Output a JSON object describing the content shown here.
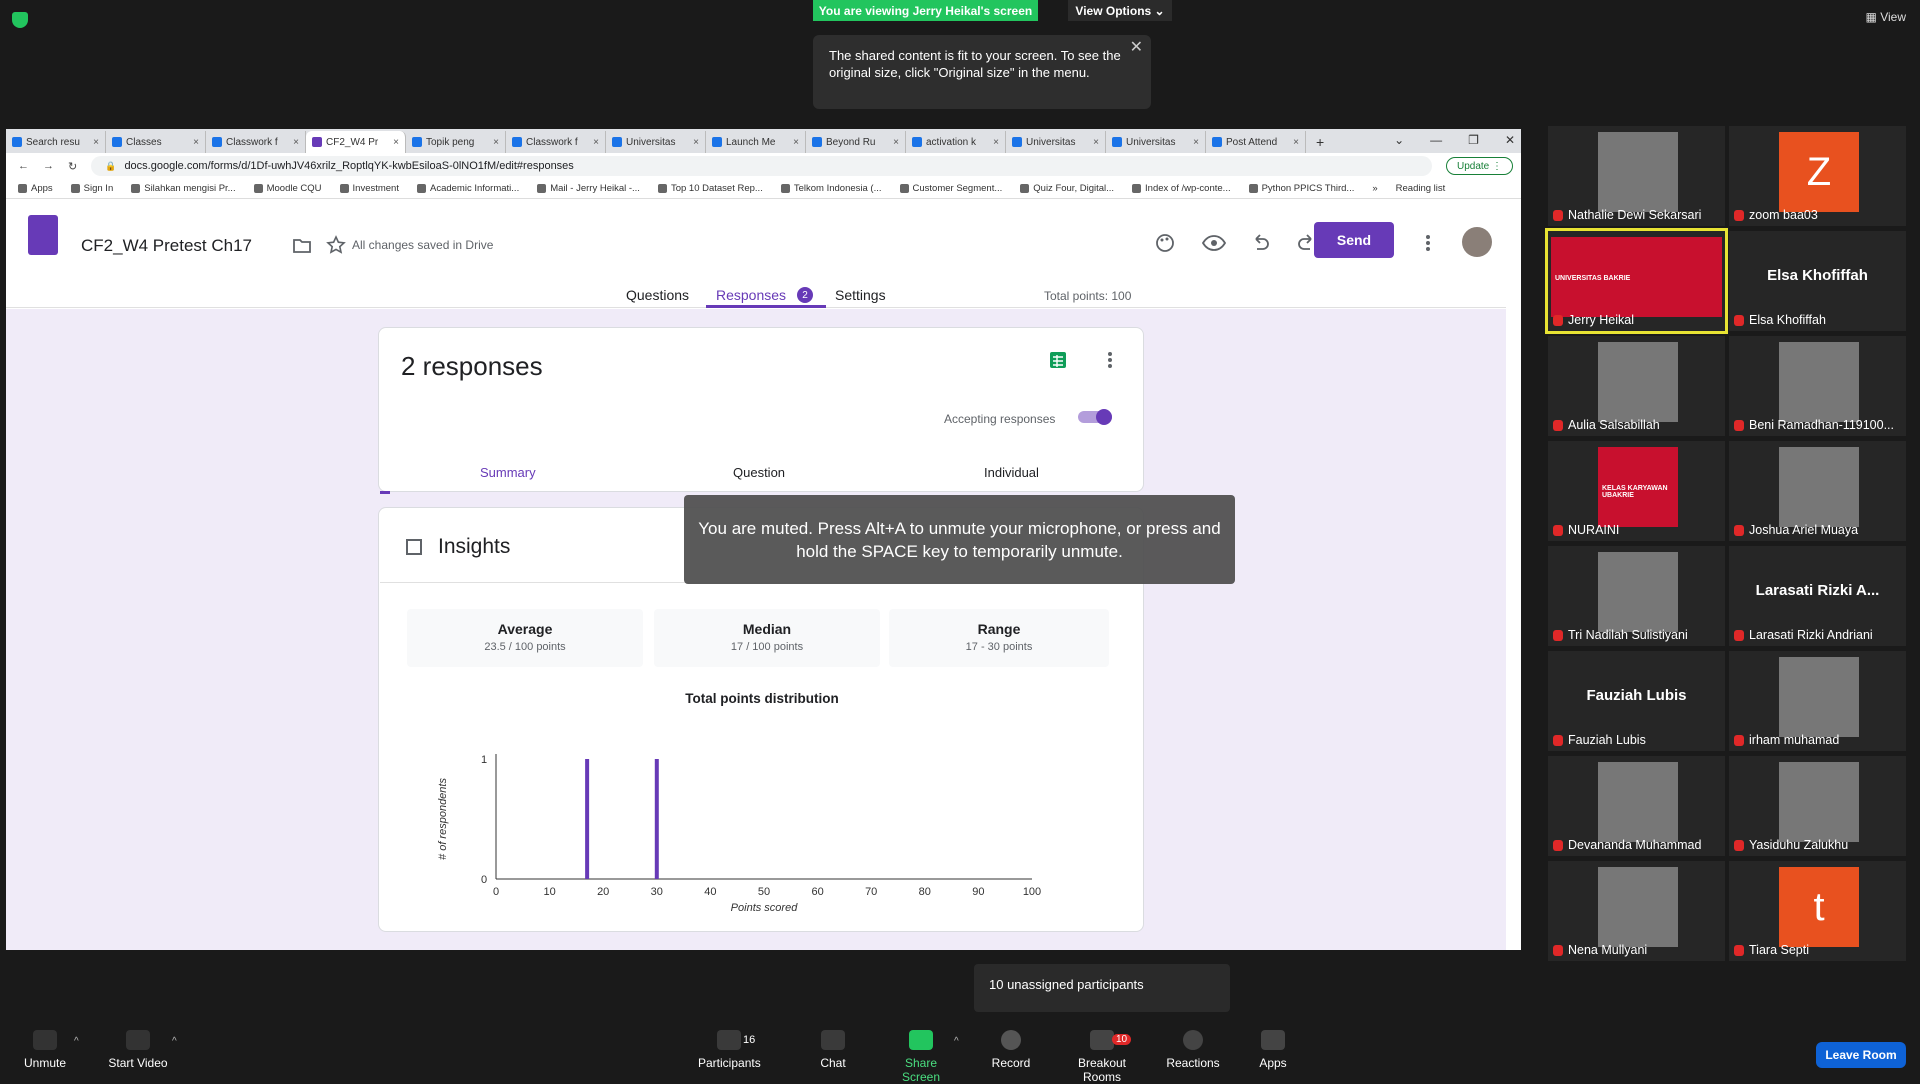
{
  "zoom": {
    "banner": "You are viewing Jerry Heikal's screen",
    "view_options": "View Options ⌄",
    "tooltip": "The shared content is fit to your screen. To see the original size, click \"Original size\" in the menu.",
    "tooltip_close": "✕",
    "view_button": "▦ View"
  },
  "browser": {
    "tabs": [
      "Search resu",
      "Classes",
      "Classwork f",
      "CF2_W4 Pr",
      "Topik peng",
      "Classwork f",
      "Universitas",
      "Launch Me",
      "Beyond Ru",
      "activation k",
      "Universitas",
      "Universitas",
      "Post Attend"
    ],
    "tab_close": "×",
    "new_tab": "+",
    "win_ctl": [
      "⌄",
      "—",
      "❐",
      "✕"
    ],
    "nav": [
      "←",
      "→",
      "↻",
      "🔒"
    ],
    "url": "docs.google.com/forms/d/1Df-uwhJV46xrilz_RoptlqYK-kwbEsiloaS-0lNO1fM/edit#responses",
    "update": "Update ⋮",
    "bookmarks": [
      "Apps",
      "Sign In",
      "Silahkan mengisi Pr...",
      "Moodle CQU",
      "Investment",
      "Academic Informati...",
      "Mail - Jerry Heikal -...",
      "Top 10 Dataset Rep...",
      "Telkom Indonesia (...",
      "Customer Segment...",
      "Quiz Four, Digital...",
      "Index of /wp-conte...",
      "Python PPICS Third..."
    ],
    "bookmark_more": "»",
    "reading_list": "Reading list"
  },
  "form": {
    "title": "CF2_W4 Pretest Ch17",
    "saved": "All changes saved in Drive",
    "send": "Send",
    "tabs": {
      "questions": "Questions",
      "responses": "Responses",
      "badge": "2",
      "settings": "Settings"
    },
    "total_points": "Total points: 100",
    "responses_title": "2 responses",
    "accepting": "Accepting responses",
    "subtabs": {
      "summary": "Summary",
      "question": "Question",
      "individual": "Individual"
    },
    "insights": "Insights",
    "stats": [
      {
        "label": "Average",
        "value": "23.5 / 100 points"
      },
      {
        "label": "Median",
        "value": "17 / 100 points"
      },
      {
        "label": "Range",
        "value": "17 - 30 points"
      }
    ],
    "help": "?"
  },
  "chart_data": {
    "type": "bar",
    "title": "Total points distribution",
    "xlabel": "Points scored",
    "ylabel": "# of respondents",
    "xlim": [
      0,
      100
    ],
    "ylim": [
      0,
      1
    ],
    "xticks": [
      0,
      10,
      20,
      30,
      40,
      50,
      60,
      70,
      80,
      90,
      100
    ],
    "yticks": [
      0,
      1
    ],
    "x": [
      17,
      30
    ],
    "values": [
      1,
      1
    ],
    "color": "#673ab7"
  },
  "muted": "You are muted. Press Alt+A to unmute your microphone, or press and hold the SPACE key to temporarily unmute.",
  "gallery": [
    {
      "name": "Nathalie Dewi Sekarsari",
      "kind": "photo"
    },
    {
      "name": "zoom baa03",
      "kind": "letter",
      "letter": "Z"
    },
    {
      "name": "Jerry Heikal",
      "kind": "photo",
      "slide_text": "UNIVERSITAS BAKRIE"
    },
    {
      "name": "Elsa Khofiffah",
      "kind": "text",
      "big": "Elsa Khofiffah"
    },
    {
      "name": "Aulia Salsabillah",
      "kind": "photo"
    },
    {
      "name": "Beni Ramadhan-119100...",
      "kind": "photo"
    },
    {
      "name": "NURAINI",
      "kind": "photo",
      "slide_text": "KELAS KARYAWAN UBAKRIE"
    },
    {
      "name": "Joshua Ariel Muaya",
      "kind": "photo"
    },
    {
      "name": "Tri Nadilah Sulistiyani",
      "kind": "photo"
    },
    {
      "name": "Larasati Rizki Andriani",
      "kind": "text",
      "big": "Larasati Rizki A..."
    },
    {
      "name": "Fauziah Lubis",
      "kind": "text",
      "big": "Fauziah Lubis"
    },
    {
      "name": "irham muhamad",
      "kind": "photo"
    },
    {
      "name": "Devananda Muhammad",
      "kind": "photo"
    },
    {
      "name": "Yasiduhu Zalukhu",
      "kind": "photo"
    },
    {
      "name": "Nena Mullyani",
      "kind": "photo"
    },
    {
      "name": "Tiara Septi",
      "kind": "letter",
      "letter": "t"
    }
  ],
  "unassigned": "10 unassigned participants",
  "toolbar": {
    "unmute": "Unmute",
    "start_video": "Start Video",
    "participants": "Participants",
    "participants_count": "16",
    "chat": "Chat",
    "share": "Share Screen",
    "record": "Record",
    "breakout": "Breakout Rooms",
    "breakout_badge": "10",
    "reactions": "Reactions",
    "apps": "Apps",
    "leave": "Leave Room",
    "caret": "^"
  }
}
